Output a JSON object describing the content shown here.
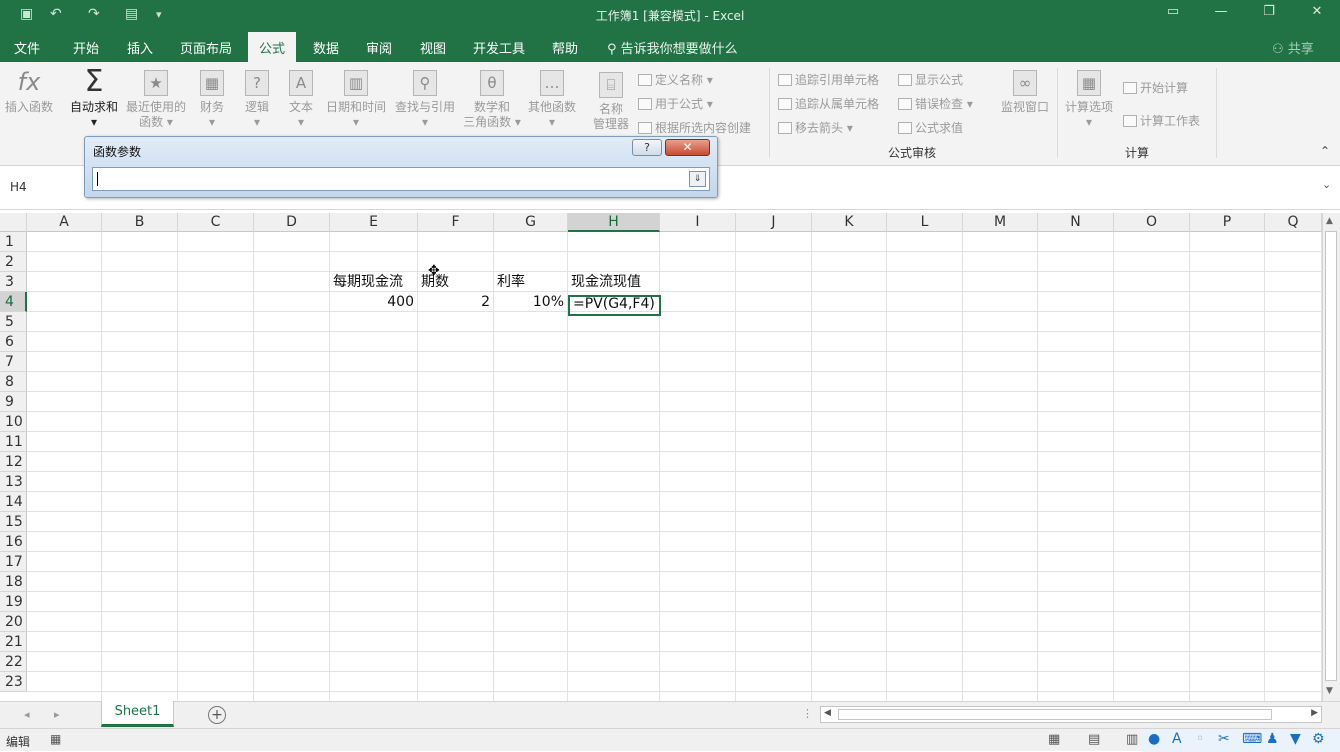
{
  "window": {
    "title": "工作簿1  [兼容模式]  -  Excel"
  },
  "tabs": [
    "文件",
    "开始",
    "插入",
    "页面布局",
    "公式",
    "数据",
    "审阅",
    "视图",
    "开发工具",
    "帮助"
  ],
  "active_tab": "公式",
  "tell_me": "告诉我你想要做什么",
  "share": "共享",
  "ribbon": {
    "insert_function": "插入函数",
    "autosum": "自动求和",
    "recent": [
      "最近使用的",
      "函数"
    ],
    "finance": "财务",
    "logic": "逻辑",
    "text": "文本",
    "datetime": "日期和时间",
    "lookup": "查找与引用",
    "math": [
      "数学和",
      "三角函数"
    ],
    "other": "其他函数",
    "name_manager": [
      "名称",
      "管理器"
    ],
    "define_name": "定义名称",
    "use_in_formula": "用于公式",
    "create_from_selection": "根据所选内容创建",
    "trace_precedents": "追踪引用单元格",
    "trace_dependents": "追踪从属单元格",
    "remove_arrows": "移去箭头",
    "show_formulas": "显示公式",
    "error_checking": "错误检查",
    "evaluate_formula": "公式求值",
    "watch_window": "监视窗口",
    "group_audit": "公式审核",
    "calc_options": "计算选项",
    "calc_now": "开始计算",
    "calc_sheet": "计算工作表",
    "group_calc": "计算"
  },
  "name_box": "H4",
  "dialog": {
    "title": "函数参数",
    "help": "?",
    "close": "✕",
    "input_value": ""
  },
  "columns": [
    "A",
    "B",
    "C",
    "D",
    "E",
    "F",
    "G",
    "H",
    "I",
    "J",
    "K",
    "L",
    "M",
    "N",
    "O",
    "P",
    "Q"
  ],
  "rows": [
    "1",
    "2",
    "3",
    "4",
    "5",
    "6",
    "7",
    "8",
    "9",
    "10",
    "11",
    "12",
    "13",
    "14",
    "15",
    "16",
    "17",
    "18",
    "19",
    "20",
    "21",
    "22",
    "23"
  ],
  "cells": {
    "E3": "每期现金流",
    "F3": "期数",
    "G3": "利率",
    "H3": "现金流现值",
    "E4": "400",
    "F4": "2",
    "G4": "10%",
    "H4": "=PV(G4,F4)"
  },
  "sheet_tab": "Sheet1",
  "status": "编辑",
  "accent_color": "#217346"
}
